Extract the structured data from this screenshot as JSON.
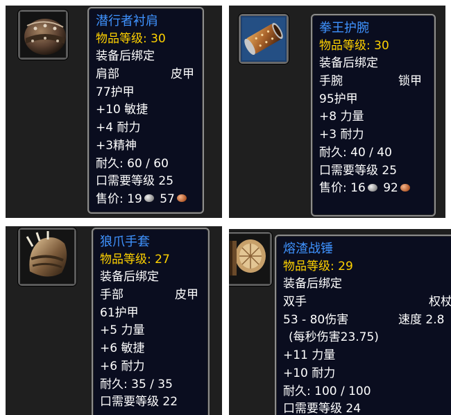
{
  "items": [
    {
      "name": "潜行者衬肩",
      "item_level_label": "物品等级: ",
      "item_level": "30",
      "bind": "装备后绑定",
      "slot": "肩部",
      "type": "皮甲",
      "armor": "77护甲",
      "stats": [
        "+10 敏捷",
        "+4 耐力",
        "+3精神"
      ],
      "durability": "耐久: 60 / 60",
      "requires": "口需要等级 25",
      "sell_label": "售价: ",
      "sell_silver": "19",
      "sell_copper": "57",
      "icon": "leather-shoulders-icon"
    },
    {
      "name": "拳王护腕",
      "item_level_label": "物品等级: ",
      "item_level": "30",
      "bind": "装备后绑定",
      "slot": "手腕",
      "type": "锁甲",
      "armor": "95护甲",
      "stats": [
        "+8 力量",
        "+3 耐力"
      ],
      "durability": "耐久: 40 / 40",
      "requires": "口需要等级 25",
      "sell_label": "售价: ",
      "sell_silver": "16",
      "sell_copper": "92",
      "icon": "bracer-icon"
    },
    {
      "name": "狼爪手套",
      "item_level_label": "物品等级: ",
      "item_level": "27",
      "bind": "装备后绑定",
      "slot": "手部",
      "type": "皮甲",
      "armor": "61护甲",
      "stats": [
        "+5 力量",
        "+6 敏捷",
        "+6 耐力"
      ],
      "durability": "耐久: 35 / 35",
      "requires": "口需要等级 22",
      "icon": "clawed-gloves-icon"
    },
    {
      "name": "熔渣战锤",
      "item_level_label": "物品等级: ",
      "item_level": "29",
      "bind": "装备后绑定",
      "slot": "双手",
      "type": "权杖",
      "damage": "53 - 80伤害",
      "speed": "速度 2.8",
      "dps": "(每秒伤害23.75)",
      "stats": [
        "+11 力量",
        "+10 耐力"
      ],
      "durability": "耐久: 100 / 100",
      "requires": "口需要等级 24",
      "icon": "war-hammer-icon"
    }
  ],
  "colors": {
    "name": "#3f93ff",
    "item_level": "#ffd200",
    "text": "#ffffff",
    "tooltip_bg": "#0a0d1f",
    "border": "#8c8c8c"
  }
}
